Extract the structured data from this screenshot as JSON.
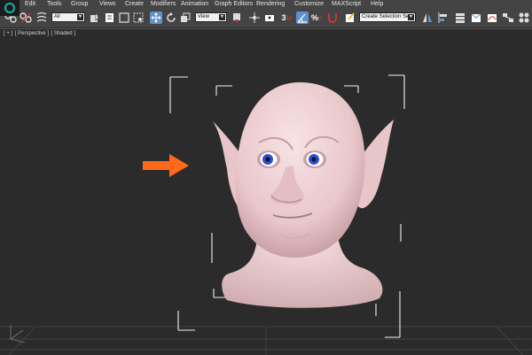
{
  "menu": {
    "items": [
      "Edit",
      "Tools",
      "Group",
      "Views",
      "Create",
      "Modifiers",
      "Animation",
      "Graph Editors",
      "Rendering",
      "Customize",
      "MAXScript",
      "Help"
    ]
  },
  "toolbar": {
    "selection_filter": "All",
    "reference_coord": "View",
    "named_selection_placeholder": "Create Selection Se",
    "angle_snap_label": "3",
    "percent_snap_label": "%"
  },
  "viewport": {
    "label_plus": "[ + ]",
    "label_view": "[ Perspective ]",
    "label_shading": "[ Shaded ]"
  },
  "colors": {
    "ui_gray": "#444444",
    "viewport_bg": "#2b2b2b",
    "skin": "#f0d3d6",
    "eye_iris": "#2b4fd8",
    "arrow": "#ff6a1a",
    "logo_accent": "#17b0a8"
  }
}
